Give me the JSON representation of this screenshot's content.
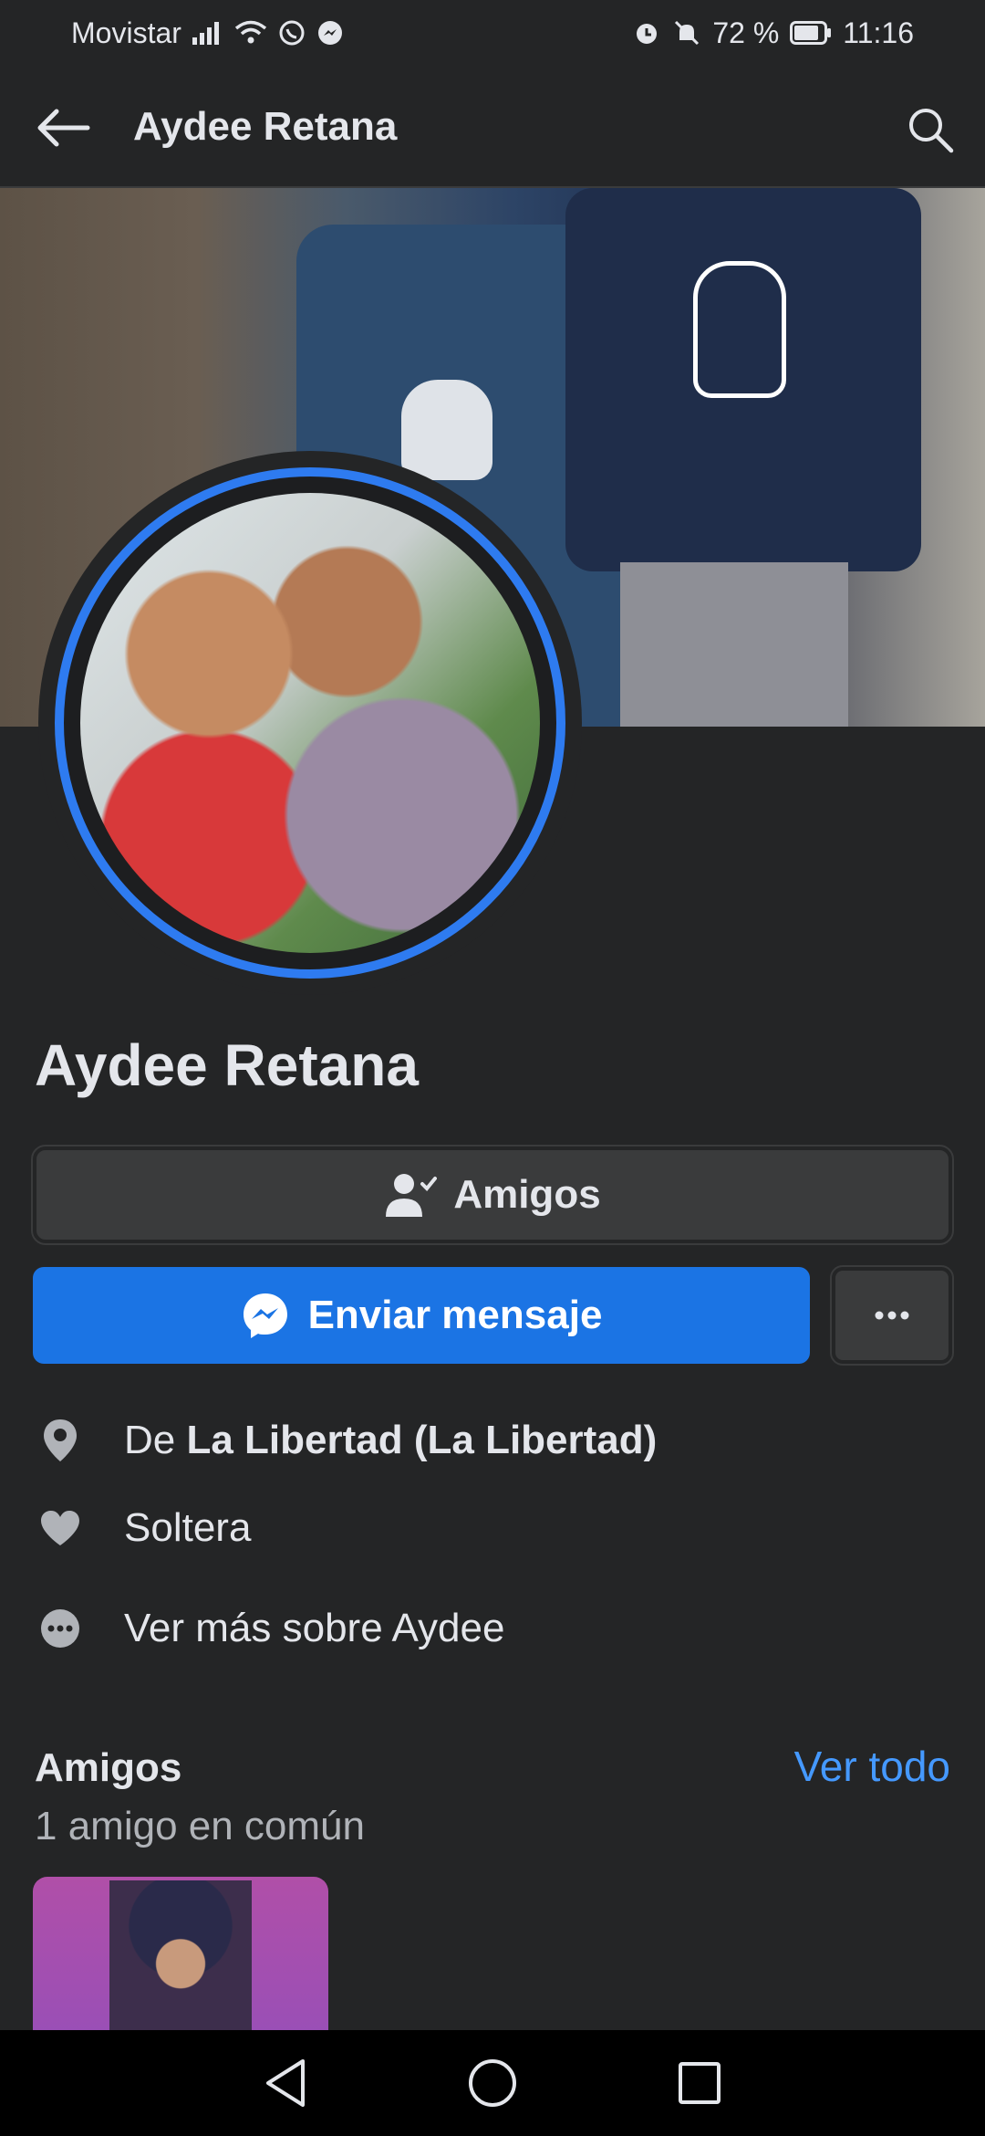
{
  "status_bar": {
    "carrier": "Movistar",
    "battery": "72 %",
    "time": "11:16"
  },
  "app_bar": {
    "title": "Aydee Retana",
    "back_icon": "arrow-left-icon",
    "search_icon": "search-icon"
  },
  "profile": {
    "name": "Aydee Retana"
  },
  "actions": {
    "friends_label": "Amigos",
    "message_label": "Enviar mensaje",
    "more_label": "···"
  },
  "details": {
    "hometown_prefix": "De",
    "hometown": "La Libertad (La Libertad)",
    "relationship": "Soltera",
    "see_more": "Ver más sobre Aydee"
  },
  "friends_section": {
    "title": "Amigos",
    "see_all": "Ver todo",
    "mutual": "1 amigo en común"
  },
  "colors": {
    "background": "#242526",
    "accent": "#1b74e4",
    "link": "#4599ff",
    "button_gray": "#3a3b3c"
  }
}
